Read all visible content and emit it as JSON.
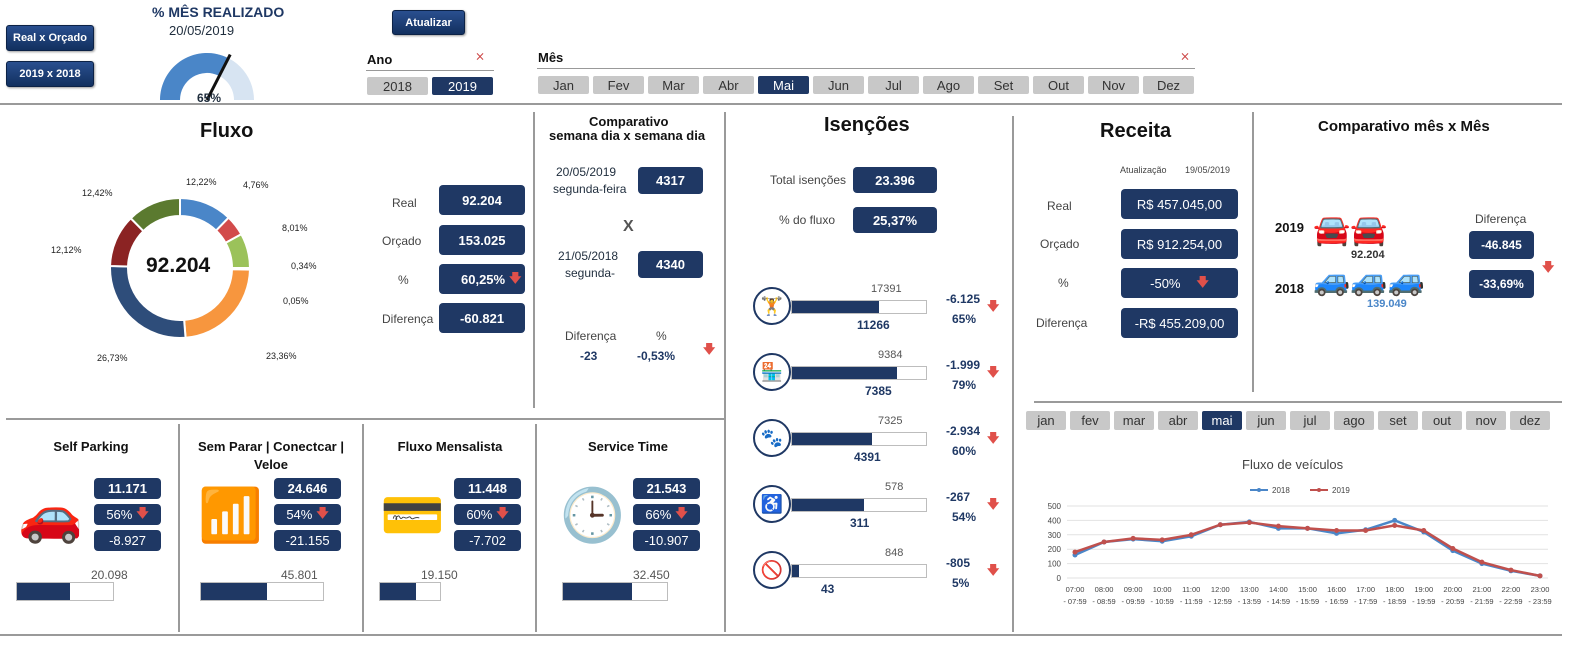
{
  "header": {
    "btn_real_orcado": "Real x Orçado",
    "btn_2019_2018": "2019 x 2018",
    "gauge_title": "% MÊS REALIZADO",
    "gauge_date": "20/05/2019",
    "gauge_value": "65%",
    "gauge_fraction": 0.65,
    "btn_atualizar": "Atualizar",
    "ano_label": "Ano",
    "anos": [
      "2018",
      "2019"
    ],
    "mes_label": "Mês",
    "meses": [
      "Jan",
      "Fev",
      "Mar",
      "Abr",
      "Mai",
      "Jun",
      "Jul",
      "Ago",
      "Set",
      "Out",
      "Nov",
      "Dez"
    ]
  },
  "fluxo": {
    "title": "Fluxo",
    "center": "92.204",
    "donut_pct": [
      "12,22%",
      "4,76%",
      "8,01%",
      "0,34%",
      "0,05%",
      "23,36%",
      "26,73%",
      "12,12%",
      "12,42%"
    ],
    "donut_values": [
      12.22,
      4.76,
      8.01,
      0.34,
      0.05,
      23.36,
      26.73,
      12.12,
      12.42
    ],
    "donut_colors": [
      "#4a86c8",
      "#d24b4b",
      "#9bc25a",
      "#7fb3d5",
      "#b0b0b0",
      "#f7963e",
      "#2e4d7a",
      "#8b2323",
      "#5b7a2f"
    ],
    "labels": [
      "Real",
      "Orçado",
      "%",
      "Diferença"
    ],
    "values": [
      "92.204",
      "153.025",
      "60,25%",
      "-60.821"
    ]
  },
  "comparativo_semana": {
    "title1": "Comparativo",
    "title2": "semana dia x semana dia",
    "date1": "20/05/2019",
    "day1": "segunda-feira",
    "val1": "4317",
    "x": "X",
    "date2": "21/05/2018",
    "day2": "segunda-",
    "val2": "4340",
    "dif_label": "Diferença",
    "pct_label": "%",
    "dif_value": "-23",
    "pct_value": "-0,53%"
  },
  "isencoes": {
    "title": "Isenções",
    "total_label": "Total isenções",
    "total_value": "23.396",
    "pct_label": "% do fluxo",
    "pct_value": "25,37%",
    "items": [
      {
        "icon": "gym-icon",
        "glyph": "🏋",
        "max": "17391",
        "value": "11266",
        "fill": 0.648,
        "dif": "-6.125",
        "pct": "65%"
      },
      {
        "icon": "store-icon",
        "glyph": "🏪",
        "max": "9384",
        "value": "7385",
        "fill": 0.787,
        "dif": "-1.999",
        "pct": "79%"
      },
      {
        "icon": "paw-icon",
        "glyph": "🐾",
        "max": "7325",
        "value": "4391",
        "fill": 0.599,
        "dif": "-2.934",
        "pct": "60%"
      },
      {
        "icon": "wheelchair-icon",
        "glyph": "♿",
        "max": "578",
        "value": "311",
        "fill": 0.538,
        "dif": "-267",
        "pct": "54%"
      },
      {
        "icon": "no-money-icon",
        "glyph": "🚫",
        "max": "848",
        "value": "43",
        "fill": 0.051,
        "dif": "-805",
        "pct": "5%"
      }
    ]
  },
  "receita": {
    "title": "Receita",
    "atualizacao_label": "Atualização",
    "atualizacao_date": "19/05/2019",
    "labels": [
      "Real",
      "Orçado",
      "%",
      "Diferença"
    ],
    "values": [
      "R$ 457.045,00",
      "R$ 912.254,00",
      "-50%",
      "-R$ 455.209,00"
    ]
  },
  "comparativo_mes": {
    "title": "Comparativo mês x Mês",
    "year1": "2019",
    "val1": "92.204",
    "year2": "2018",
    "val2": "139.049",
    "dif_label": "Diferença",
    "dif1": "-46.845",
    "dif2": "-33,69%"
  },
  "mini": [
    {
      "title": "Self Parking",
      "icon": "car-icon",
      "glyph": "🚗",
      "v1": "11.171",
      "v2": "56%",
      "v3": "-8.927",
      "max": "20.098",
      "fill": 0.556
    },
    {
      "title": "Sem Parar | Conectcar | Veloe",
      "icon": "wifi-icon",
      "glyph": "📶",
      "v1": "24.646",
      "v2": "54%",
      "v3": "-21.155",
      "max": "45.801",
      "fill": 0.538
    },
    {
      "title": "Fluxo Mensalista",
      "icon": "cards-icon",
      "glyph": "💳",
      "v1": "11.448",
      "v2": "60%",
      "v3": "-7.702",
      "max": "19.150",
      "fill": 0.598
    },
    {
      "title": "Service Time",
      "icon": "clock-icon",
      "glyph": "🕒",
      "v1": "21.543",
      "v2": "66%",
      "v3": "-10.907",
      "max": "32.450",
      "fill": 0.664
    }
  ],
  "chart_months": [
    "jan",
    "fev",
    "mar",
    "abr",
    "mai",
    "jun",
    "jul",
    "ago",
    "set",
    "out",
    "nov",
    "dez"
  ],
  "chart_data": {
    "type": "line",
    "title": "Fluxo de veículos",
    "categories": [
      "07:00 - 07:59",
      "08:00 - 08:59",
      "09:00 - 09:59",
      "10:00 - 10:59",
      "11:00 - 11:59",
      "12:00 - 12:59",
      "13:00 - 13:59",
      "14:00 - 14:59",
      "15:00 - 15:59",
      "16:00 - 16:59",
      "17:00 - 17:59",
      "18:00 - 18:59",
      "19:00 - 19:59",
      "20:00 - 20:59",
      "21:00 - 21:59",
      "22:00 - 22:59",
      "23:00 - 23:59"
    ],
    "series": [
      {
        "name": "2018",
        "color": "#4a86c8",
        "values": [
          160,
          250,
          270,
          255,
          290,
          370,
          390,
          345,
          345,
          310,
          335,
          400,
          320,
          190,
          100,
          50,
          15
        ]
      },
      {
        "name": "2019",
        "color": "#c0504d",
        "values": [
          180,
          250,
          275,
          265,
          300,
          370,
          385,
          360,
          345,
          330,
          330,
          365,
          330,
          205,
          110,
          55,
          15
        ]
      }
    ],
    "ylim": [
      0,
      500
    ],
    "yticks": [
      "0",
      "100",
      "200",
      "300",
      "400",
      "500"
    ],
    "legend": "top",
    "grid": true
  }
}
